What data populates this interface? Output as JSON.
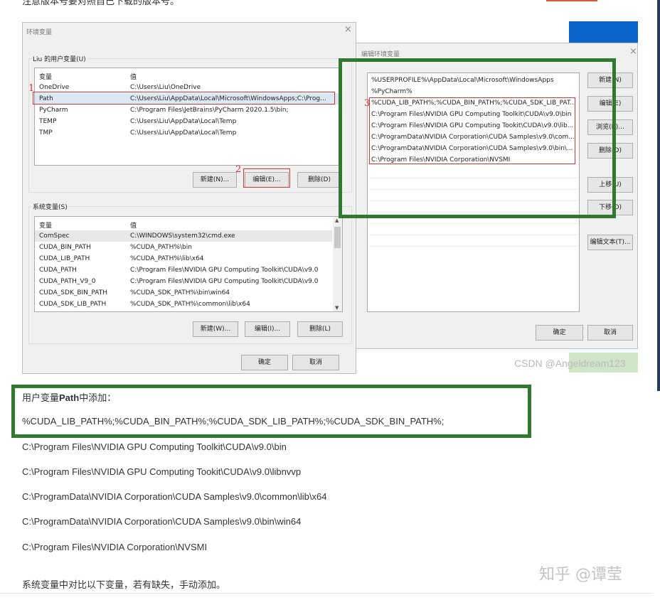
{
  "top_fragment": "注意版本号要对照自己下载的版本号。",
  "env_dialog": {
    "title": "环境变量",
    "close": "×",
    "user_group": "Liu 的用户变量(U)",
    "col_var": "变量",
    "col_val": "值",
    "user_vars": [
      {
        "name": "OneDrive",
        "value": "C:\\Users\\Liu\\OneDrive"
      },
      {
        "name": "Path",
        "value": "C:\\Users\\Liu\\AppData\\Local\\Microsoft\\WindowsApps;C:\\Prog..."
      },
      {
        "name": "PyCharm",
        "value": "C:\\Program Files\\JetBrains\\PyCharm 2020.1.5\\bin;"
      },
      {
        "name": "TEMP",
        "value": "C:\\Users\\Liu\\AppData\\Local\\Temp"
      },
      {
        "name": "TMP",
        "value": "C:\\Users\\Liu\\AppData\\Local\\Temp"
      }
    ],
    "user_buttons": {
      "new": "新建(N)...",
      "edit": "编辑(E)...",
      "delete": "删除(D)"
    },
    "sys_group": "系统变量(S)",
    "sys_vars": [
      {
        "name": "ComSpec",
        "value": "C:\\WINDOWS\\system32\\cmd.exe"
      },
      {
        "name": "CUDA_BIN_PATH",
        "value": "%CUDA_PATH%\\bin"
      },
      {
        "name": "CUDA_LIB_PATH",
        "value": "%CUDA_PATH%\\lib\\x64"
      },
      {
        "name": "CUDA_PATH",
        "value": "C:\\Program Files\\NVIDIA GPU Computing Toolkit\\CUDA\\v9.0"
      },
      {
        "name": "CUDA_PATH_V9_0",
        "value": "C:\\Program Files\\NVIDIA GPU Computing Toolkit\\CUDA\\v9.0"
      },
      {
        "name": "CUDA_SDK_BIN_PATH",
        "value": "%CUDA_SDK_PATH%\\bin\\win64"
      },
      {
        "name": "CUDA_SDK_LIB_PATH",
        "value": "%CUDA_SDK_PATH%\\common\\lib\\x64"
      }
    ],
    "sys_buttons": {
      "new": "新建(W)...",
      "edit": "编辑(I)...",
      "delete": "删除(L)"
    },
    "ok": "确定",
    "cancel": "取消"
  },
  "edit_dialog": {
    "title": "编辑环境变量",
    "close": "×",
    "entries": [
      "%USERPROFILE%\\AppData\\Local\\Microsoft\\WindowsApps",
      "%PyCharm%",
      "%CUDA_LIB_PATH%;%CUDA_BIN_PATH%;%CUDA_SDK_LIB_PAT...",
      "C:\\Program Files\\NVIDIA GPU Computing Toolkit\\CUDA\\v9.0\\bin",
      "C:\\Program Files\\NVIDIA GPU Computing Tookit\\CUDA\\v9.0\\lib...",
      "C:\\ProgramData\\NVIDIA Corporation\\CUDA Samples\\v9.0\\com...",
      "C:\\ProgramData\\NVIDIA Corporation\\CUDA Samples\\v9.0\\bin\\...",
      "C:\\Program Files\\NVIDIA Corporation\\NVSMI"
    ],
    "buttons": {
      "new": "新建(N)",
      "edit": "编辑(E)",
      "browse": "浏览(B)...",
      "delete": "删除(D)",
      "move_up": "上移(U)",
      "move_down": "下移(O)",
      "edit_text": "编辑文本(T)..."
    },
    "ok": "确定",
    "cancel": "取消"
  },
  "annotations": {
    "one": "1",
    "two": "2",
    "three": "3"
  },
  "watermark_csdn": "CSDN @Angeldream123",
  "article": {
    "line1_prefix": "用户变量",
    "line1_bold": "Path",
    "line1_suffix": "中添加：",
    "line2": "%CUDA_LIB_PATH%;%CUDA_BIN_PATH%;%CUDA_SDK_LIB_PATH%;%CUDA_SDK_BIN_PATH%;",
    "line3": "C:\\Program Files\\NVIDIA GPU Computing Toolkit\\CUDA\\v9.0\\bin",
    "line4": "C:\\Program Files\\NVIDIA GPU Computing Tookit\\CUDA\\v9.0\\libnvvp",
    "line5": "C:\\ProgramData\\NVIDIA Corporation\\CUDA Samples\\v9.0\\common\\lib\\x64",
    "line6": "C:\\ProgramData\\NVIDIA Corporation\\CUDA Samples\\v9.0\\bin\\win64",
    "line7": "C:\\Program Files\\NVIDIA Corporation\\NVSMI",
    "line8": "系统变量中对比以下变量，若有缺失，手动添加。"
  },
  "watermark_zhihu": "知乎 @谭莹",
  "colors": {
    "annotation_red": "#e03030",
    "highlight_green": "#2f7a2f"
  }
}
